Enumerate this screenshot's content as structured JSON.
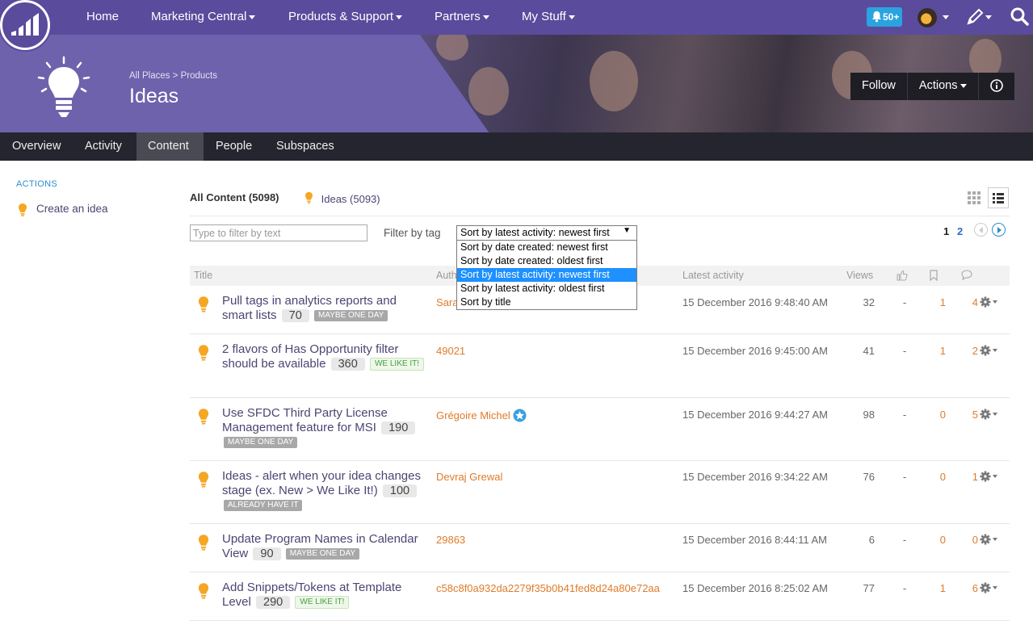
{
  "nav": {
    "items": [
      {
        "label": "Home",
        "caret": false
      },
      {
        "label": "Marketing Central",
        "caret": true
      },
      {
        "label": "Products & Support",
        "caret": true
      },
      {
        "label": "Partners",
        "caret": true
      },
      {
        "label": "My Stuff",
        "caret": true
      }
    ],
    "notifications": "50+"
  },
  "header": {
    "breadcrumb": "All Places > Products",
    "title": "Ideas",
    "follow": "Follow",
    "actions": "Actions"
  },
  "tabs": [
    "Overview",
    "Activity",
    "Content",
    "People",
    "Subspaces"
  ],
  "active_tab": "Content",
  "sidebar": {
    "heading": "ACTIONS",
    "create": "Create an idea"
  },
  "content": {
    "all": "All Content (5098)",
    "ideas": "Ideas (5093)",
    "filter_placeholder": "Type to filter by text",
    "filter_tag": "Filter by tag",
    "sort_selected": "Sort by latest activity: newest first",
    "sort_options": [
      "Sort by date created: newest first",
      "Sort by date created: oldest first",
      "Sort by latest activity: newest first",
      "Sort by latest activity: oldest first",
      "Sort by title"
    ],
    "pages": [
      "1",
      "2"
    ]
  },
  "table": {
    "headers": {
      "title": "Title",
      "author": "Author",
      "latest": "Latest activity",
      "views": "Views"
    },
    "rows": [
      {
        "title": "Pull tags in analytics reports and smart lists",
        "votes": "70",
        "stage": "MAYBE ONE DAY",
        "stage_type": "maybe",
        "author": "Sara",
        "date": "15 December 2016 9:48:40 AM",
        "views": "32",
        "likes": "-",
        "bookmarks": "1",
        "comments": "4"
      },
      {
        "title": "2 flavors of Has Opportunity filter should be available",
        "votes": "360",
        "stage": "WE LIKE IT!",
        "stage_type": "like",
        "author": "49021",
        "date": "15 December 2016 9:45:00 AM",
        "views": "41",
        "likes": "-",
        "bookmarks": "1",
        "comments": "2"
      },
      {
        "title": "Use SFDC Third Party License Management feature for MSI",
        "votes": "190",
        "stage": "MAYBE ONE DAY",
        "stage_type": "maybe",
        "author": "Grégoire Michel",
        "date": "15 December 2016 9:44:27 AM",
        "views": "98",
        "likes": "-",
        "bookmarks": "0",
        "comments": "5"
      },
      {
        "title": "Ideas - alert when your idea changes stage (ex. New > We Like It!)",
        "votes": "100",
        "stage": "ALREADY HAVE IT",
        "stage_type": "have",
        "author": "Devraj Grewal",
        "date": "15 December 2016 9:34:22 AM",
        "views": "76",
        "likes": "-",
        "bookmarks": "0",
        "comments": "1"
      },
      {
        "title": "Update Program Names in Calendar View",
        "votes": "90",
        "stage": "MAYBE ONE DAY",
        "stage_type": "maybe",
        "author": "29863",
        "date": "15 December 2016 8:44:11 AM",
        "views": "6",
        "likes": "-",
        "bookmarks": "0",
        "comments": "0"
      },
      {
        "title": "Add Snippets/Tokens at Template Level",
        "votes": "290",
        "stage": "WE LIKE IT!",
        "stage_type": "like",
        "author": "c58c8f0a932da2279f35b0b41fed8d24a80e72aa",
        "date": "15 December 2016 8:25:02 AM",
        "views": "77",
        "likes": "-",
        "bookmarks": "1",
        "comments": "6"
      }
    ]
  }
}
